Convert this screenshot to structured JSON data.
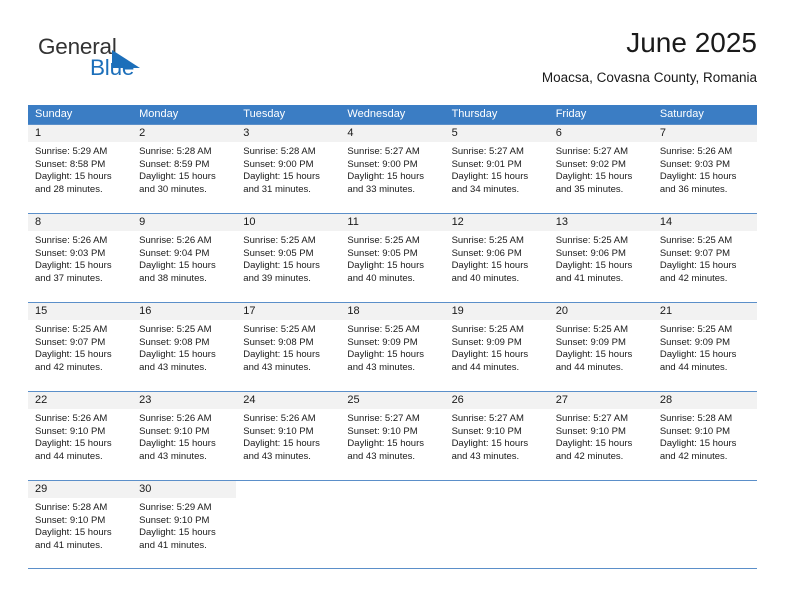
{
  "logo": {
    "word1": "General",
    "word2": "Blue",
    "brand_color": "#1c6fba"
  },
  "header": {
    "title": "June 2025",
    "subtitle": "Moacsa, Covasna County, Romania"
  },
  "calendar": {
    "header_bg": "#3b7dc4",
    "weekdays": [
      "Sunday",
      "Monday",
      "Tuesday",
      "Wednesday",
      "Thursday",
      "Friday",
      "Saturday"
    ],
    "weeks": [
      [
        {
          "date": "1",
          "sunrise": "Sunrise: 5:29 AM",
          "sunset": "Sunset: 8:58 PM",
          "daylight_1": "Daylight: 15 hours",
          "daylight_2": "and 28 minutes."
        },
        {
          "date": "2",
          "sunrise": "Sunrise: 5:28 AM",
          "sunset": "Sunset: 8:59 PM",
          "daylight_1": "Daylight: 15 hours",
          "daylight_2": "and 30 minutes."
        },
        {
          "date": "3",
          "sunrise": "Sunrise: 5:28 AM",
          "sunset": "Sunset: 9:00 PM",
          "daylight_1": "Daylight: 15 hours",
          "daylight_2": "and 31 minutes."
        },
        {
          "date": "4",
          "sunrise": "Sunrise: 5:27 AM",
          "sunset": "Sunset: 9:00 PM",
          "daylight_1": "Daylight: 15 hours",
          "daylight_2": "and 33 minutes."
        },
        {
          "date": "5",
          "sunrise": "Sunrise: 5:27 AM",
          "sunset": "Sunset: 9:01 PM",
          "daylight_1": "Daylight: 15 hours",
          "daylight_2": "and 34 minutes."
        },
        {
          "date": "6",
          "sunrise": "Sunrise: 5:27 AM",
          "sunset": "Sunset: 9:02 PM",
          "daylight_1": "Daylight: 15 hours",
          "daylight_2": "and 35 minutes."
        },
        {
          "date": "7",
          "sunrise": "Sunrise: 5:26 AM",
          "sunset": "Sunset: 9:03 PM",
          "daylight_1": "Daylight: 15 hours",
          "daylight_2": "and 36 minutes."
        }
      ],
      [
        {
          "date": "8",
          "sunrise": "Sunrise: 5:26 AM",
          "sunset": "Sunset: 9:03 PM",
          "daylight_1": "Daylight: 15 hours",
          "daylight_2": "and 37 minutes."
        },
        {
          "date": "9",
          "sunrise": "Sunrise: 5:26 AM",
          "sunset": "Sunset: 9:04 PM",
          "daylight_1": "Daylight: 15 hours",
          "daylight_2": "and 38 minutes."
        },
        {
          "date": "10",
          "sunrise": "Sunrise: 5:25 AM",
          "sunset": "Sunset: 9:05 PM",
          "daylight_1": "Daylight: 15 hours",
          "daylight_2": "and 39 minutes."
        },
        {
          "date": "11",
          "sunrise": "Sunrise: 5:25 AM",
          "sunset": "Sunset: 9:05 PM",
          "daylight_1": "Daylight: 15 hours",
          "daylight_2": "and 40 minutes."
        },
        {
          "date": "12",
          "sunrise": "Sunrise: 5:25 AM",
          "sunset": "Sunset: 9:06 PM",
          "daylight_1": "Daylight: 15 hours",
          "daylight_2": "and 40 minutes."
        },
        {
          "date": "13",
          "sunrise": "Sunrise: 5:25 AM",
          "sunset": "Sunset: 9:06 PM",
          "daylight_1": "Daylight: 15 hours",
          "daylight_2": "and 41 minutes."
        },
        {
          "date": "14",
          "sunrise": "Sunrise: 5:25 AM",
          "sunset": "Sunset: 9:07 PM",
          "daylight_1": "Daylight: 15 hours",
          "daylight_2": "and 42 minutes."
        }
      ],
      [
        {
          "date": "15",
          "sunrise": "Sunrise: 5:25 AM",
          "sunset": "Sunset: 9:07 PM",
          "daylight_1": "Daylight: 15 hours",
          "daylight_2": "and 42 minutes."
        },
        {
          "date": "16",
          "sunrise": "Sunrise: 5:25 AM",
          "sunset": "Sunset: 9:08 PM",
          "daylight_1": "Daylight: 15 hours",
          "daylight_2": "and 43 minutes."
        },
        {
          "date": "17",
          "sunrise": "Sunrise: 5:25 AM",
          "sunset": "Sunset: 9:08 PM",
          "daylight_1": "Daylight: 15 hours",
          "daylight_2": "and 43 minutes."
        },
        {
          "date": "18",
          "sunrise": "Sunrise: 5:25 AM",
          "sunset": "Sunset: 9:09 PM",
          "daylight_1": "Daylight: 15 hours",
          "daylight_2": "and 43 minutes."
        },
        {
          "date": "19",
          "sunrise": "Sunrise: 5:25 AM",
          "sunset": "Sunset: 9:09 PM",
          "daylight_1": "Daylight: 15 hours",
          "daylight_2": "and 44 minutes."
        },
        {
          "date": "20",
          "sunrise": "Sunrise: 5:25 AM",
          "sunset": "Sunset: 9:09 PM",
          "daylight_1": "Daylight: 15 hours",
          "daylight_2": "and 44 minutes."
        },
        {
          "date": "21",
          "sunrise": "Sunrise: 5:25 AM",
          "sunset": "Sunset: 9:09 PM",
          "daylight_1": "Daylight: 15 hours",
          "daylight_2": "and 44 minutes."
        }
      ],
      [
        {
          "date": "22",
          "sunrise": "Sunrise: 5:26 AM",
          "sunset": "Sunset: 9:10 PM",
          "daylight_1": "Daylight: 15 hours",
          "daylight_2": "and 44 minutes."
        },
        {
          "date": "23",
          "sunrise": "Sunrise: 5:26 AM",
          "sunset": "Sunset: 9:10 PM",
          "daylight_1": "Daylight: 15 hours",
          "daylight_2": "and 43 minutes."
        },
        {
          "date": "24",
          "sunrise": "Sunrise: 5:26 AM",
          "sunset": "Sunset: 9:10 PM",
          "daylight_1": "Daylight: 15 hours",
          "daylight_2": "and 43 minutes."
        },
        {
          "date": "25",
          "sunrise": "Sunrise: 5:27 AM",
          "sunset": "Sunset: 9:10 PM",
          "daylight_1": "Daylight: 15 hours",
          "daylight_2": "and 43 minutes."
        },
        {
          "date": "26",
          "sunrise": "Sunrise: 5:27 AM",
          "sunset": "Sunset: 9:10 PM",
          "daylight_1": "Daylight: 15 hours",
          "daylight_2": "and 43 minutes."
        },
        {
          "date": "27",
          "sunrise": "Sunrise: 5:27 AM",
          "sunset": "Sunset: 9:10 PM",
          "daylight_1": "Daylight: 15 hours",
          "daylight_2": "and 42 minutes."
        },
        {
          "date": "28",
          "sunrise": "Sunrise: 5:28 AM",
          "sunset": "Sunset: 9:10 PM",
          "daylight_1": "Daylight: 15 hours",
          "daylight_2": "and 42 minutes."
        }
      ],
      [
        {
          "date": "29",
          "sunrise": "Sunrise: 5:28 AM",
          "sunset": "Sunset: 9:10 PM",
          "daylight_1": "Daylight: 15 hours",
          "daylight_2": "and 41 minutes."
        },
        {
          "date": "30",
          "sunrise": "Sunrise: 5:29 AM",
          "sunset": "Sunset: 9:10 PM",
          "daylight_1": "Daylight: 15 hours",
          "daylight_2": "and 41 minutes."
        },
        {
          "date": "",
          "sunrise": "",
          "sunset": "",
          "daylight_1": "",
          "daylight_2": ""
        },
        {
          "date": "",
          "sunrise": "",
          "sunset": "",
          "daylight_1": "",
          "daylight_2": ""
        },
        {
          "date": "",
          "sunrise": "",
          "sunset": "",
          "daylight_1": "",
          "daylight_2": ""
        },
        {
          "date": "",
          "sunrise": "",
          "sunset": "",
          "daylight_1": "",
          "daylight_2": ""
        },
        {
          "date": "",
          "sunrise": "",
          "sunset": "",
          "daylight_1": "",
          "daylight_2": ""
        }
      ]
    ]
  }
}
